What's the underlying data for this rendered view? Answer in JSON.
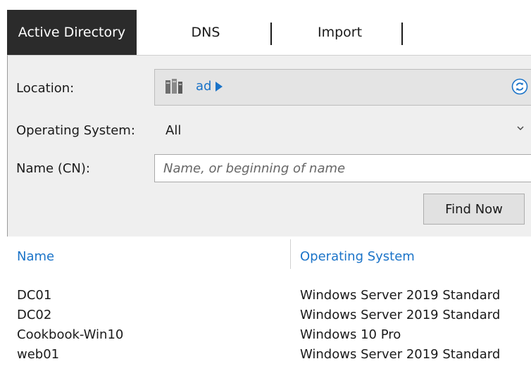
{
  "tabs": [
    {
      "label": "Active Directory",
      "active": true
    },
    {
      "label": "DNS",
      "active": false
    },
    {
      "label": "Import",
      "active": false
    }
  ],
  "search": {
    "location_label": "Location:",
    "location_value": "ad",
    "os_label": "Operating System:",
    "os_value": "All",
    "name_label": "Name (CN):",
    "name_placeholder": "Name, or beginning of name",
    "find_button": "Find Now"
  },
  "results": {
    "columns": [
      "Name",
      "Operating System"
    ],
    "rows": [
      {
        "name": "DC01",
        "os": "Windows Server 2019 Standard"
      },
      {
        "name": "DC02",
        "os": "Windows Server 2019 Standard"
      },
      {
        "name": "Cookbook-Win10",
        "os": "Windows 10 Pro"
      },
      {
        "name": "web01",
        "os": "Windows Server 2019 Standard"
      }
    ]
  },
  "icons": {
    "location": "server-icon",
    "expand": "triangle-right-icon",
    "refresh": "refresh-icon",
    "dropdown": "chevron-down-icon"
  },
  "colors": {
    "active_tab_bg": "#2b2b2b",
    "link_blue": "#1a73c8",
    "panel_bg": "#efefef"
  }
}
